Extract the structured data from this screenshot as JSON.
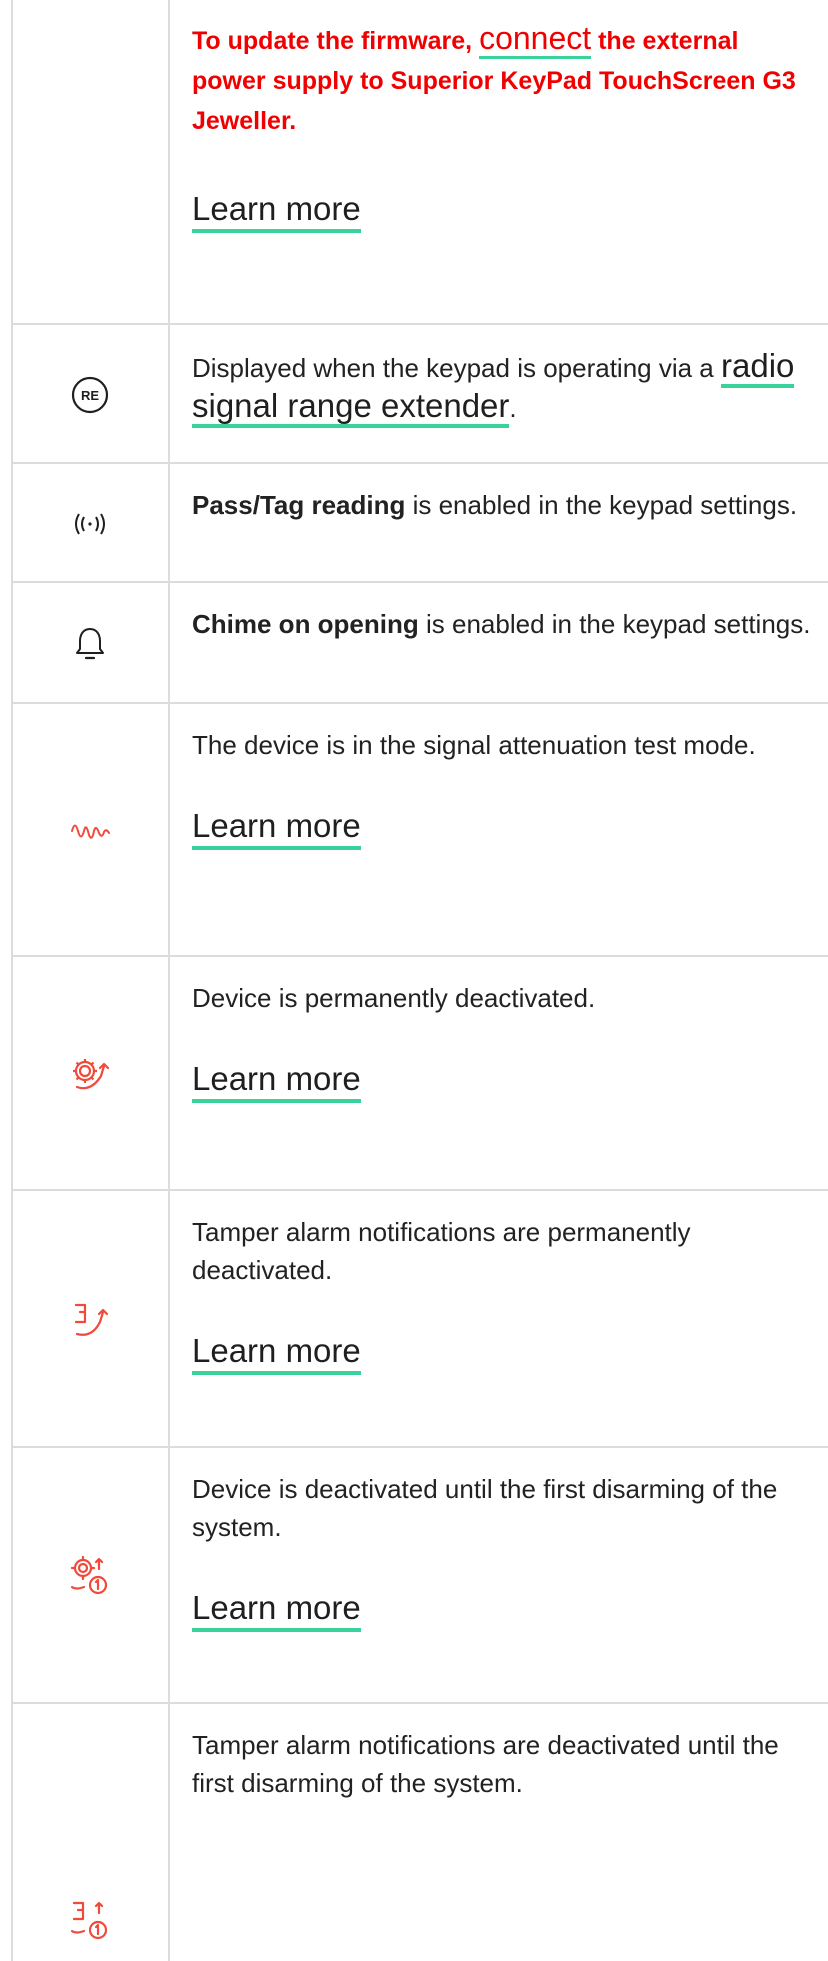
{
  "rows": [
    {
      "icon": "",
      "text_prefix": "To update the firmware, ",
      "link": "connect",
      "text_suffix": " the external power supply to Superior KeyPad TouchScreen G3 Jeweller.",
      "learn_more": "Learn more"
    },
    {
      "icon": "re-extender-icon",
      "text": "Displayed when the keypad is operating via a ",
      "link": "radio signal range extender",
      "suffix": "."
    },
    {
      "icon": "pass-tag-reading-icon",
      "bold": "Pass/Tag reading",
      "text": " is enabled in the keypad settings."
    },
    {
      "icon": "bell-icon",
      "bold": "Chime on opening",
      "text": " is enabled in the keypad settings."
    },
    {
      "icon": "signal-attenuation-icon",
      "text": "The device is in the signal attenuation test mode.",
      "learn_more": "Learn more"
    },
    {
      "icon": "device-deactivated-icon",
      "text": "Device is permanently deactivated.",
      "learn_more": "Learn more"
    },
    {
      "icon": "tamper-deactivated-icon",
      "text": "Tamper alarm notifications are permanently deactivated.",
      "learn_more": "Learn more"
    },
    {
      "icon": "device-deactivated-until-disarm-icon",
      "text": "Device is deactivated until the first disarming of the system.",
      "learn_more": "Learn more"
    },
    {
      "icon": "tamper-deactivated-until-disarm-icon",
      "text": "Tamper alarm notifications are deactivated until the first disarming of the system."
    }
  ],
  "colors": {
    "accent_red": "#f00000",
    "icon_red": "#ef4a3a",
    "link_underline": "#3ad29b",
    "border": "#dcdcdc"
  }
}
